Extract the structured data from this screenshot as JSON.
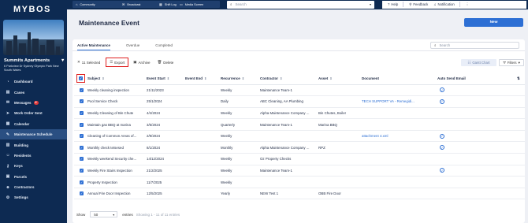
{
  "sidebar": {
    "logo": "MYBOS",
    "site_name": "Summits Apartments",
    "site_address": "6 Parkview Dr Sydney Olympic Park New South Wales",
    "items": [
      {
        "label": "Dashboard",
        "icon": "speedometer-icon"
      },
      {
        "label": "Cases",
        "icon": "briefcase-icon"
      },
      {
        "label": "Messages",
        "icon": "message-icon",
        "badge": "2"
      },
      {
        "label": "Work Order Sent",
        "icon": "send-icon"
      },
      {
        "label": "Calendar",
        "icon": "calendar-icon"
      },
      {
        "label": "Maintenance Schedule",
        "icon": "wrench-icon",
        "active": true
      },
      {
        "label": "Building",
        "icon": "building-icon"
      },
      {
        "label": "Residents",
        "icon": "people-icon"
      },
      {
        "label": "Keys",
        "icon": "key-icon"
      },
      {
        "label": "Parcels",
        "icon": "parcel-icon"
      },
      {
        "label": "Contractors",
        "icon": "contractor-icon"
      },
      {
        "label": "Settings",
        "icon": "gear-icon"
      }
    ]
  },
  "topbar": {
    "buttons": [
      "Community",
      "Broadcast",
      "Shift Log",
      "Media Screen"
    ],
    "search_placeholder": "Search",
    "help": "Help",
    "feedback": "Feedback",
    "notification": "Notification"
  },
  "page": {
    "title": "Maintenance Event",
    "new_button": "New",
    "tabs": [
      "Active Maintenance",
      "Overdue",
      "Completed"
    ],
    "search_placeholder": "Search",
    "selected_count": "11 Selected",
    "export": "Export",
    "archive": "Archive",
    "delete": "Delete",
    "gantt": "Gantt Chart",
    "filters": "Filters"
  },
  "table": {
    "columns": [
      "Subject",
      "Event Start",
      "Event End",
      "Recurrence",
      "Contractor",
      "Asset",
      "Document",
      "Auto Send Email"
    ],
    "rows": [
      {
        "subject": "Weekly cleaning inspection",
        "start": "21/11/2023",
        "end": "",
        "recurrence": "Weekly",
        "contractor": "Maintenance Team-1",
        "asset": "",
        "document": "",
        "email": true
      },
      {
        "subject": "Pool Service Check",
        "start": "25/1/2024",
        "end": "",
        "recurrence": "Daily",
        "contractor": "ABC Cleaning, AA Plumbing",
        "asset": "",
        "document": "TECH SUPPORT VA - Remegidi...",
        "email": true
      },
      {
        "subject": "Weekly Cleaning of Bin Chute",
        "start": "4/4/2024",
        "end": "",
        "recurrence": "Weekly",
        "contractor": "Alpha Maintenance Company ...",
        "asset": "Bin Chutes, Boiler",
        "document": "",
        "email": false
      },
      {
        "subject": "Maintain gas BBQ at marina",
        "start": "3/5/2024",
        "end": "",
        "recurrence": "Quarterly",
        "contractor": "Maintenance Team-1",
        "asset": "Marina BBQ",
        "document": "",
        "email": false
      },
      {
        "subject": "Cleaning of Common Areas of...",
        "start": "2/9/2024",
        "end": "",
        "recurrence": "Weekly",
        "contractor": "",
        "asset": "",
        "document": "attachment 4.xml",
        "email": true
      },
      {
        "subject": "Monthly check tetsesed",
        "start": "8/1/2024",
        "end": "",
        "recurrence": "Monthly",
        "contractor": "Alpha Maintenance Company ...",
        "asset": "RPZ",
        "document": "",
        "email": true
      },
      {
        "subject": "Weekly weekend Security che...",
        "start": "14/12/2024",
        "end": "",
        "recurrence": "Weekly",
        "contractor": "Oz Property Checks",
        "asset": "",
        "document": "",
        "email": false
      },
      {
        "subject": "Weekly Fire Stairs Inspection",
        "start": "21/2/2025",
        "end": "",
        "recurrence": "Weekly",
        "contractor": "Maintenance Team-1",
        "asset": "",
        "document": "",
        "email": true
      },
      {
        "subject": "Property Inspection",
        "start": "11/7/2025",
        "end": "",
        "recurrence": "Weekly",
        "contractor": "",
        "asset": "",
        "document": "",
        "email": false
      },
      {
        "subject": "Annual Fire Door Inspection",
        "start": "12/5/2025",
        "end": "",
        "recurrence": "Yearly",
        "contractor": "NEW Test 1",
        "asset": "OBB Fire Door",
        "document": "",
        "email": false
      }
    ]
  },
  "footer": {
    "show": "Show",
    "page_size": "50",
    "entries": "entries",
    "showing": "Showing 1 - 11 of 11 entries"
  }
}
